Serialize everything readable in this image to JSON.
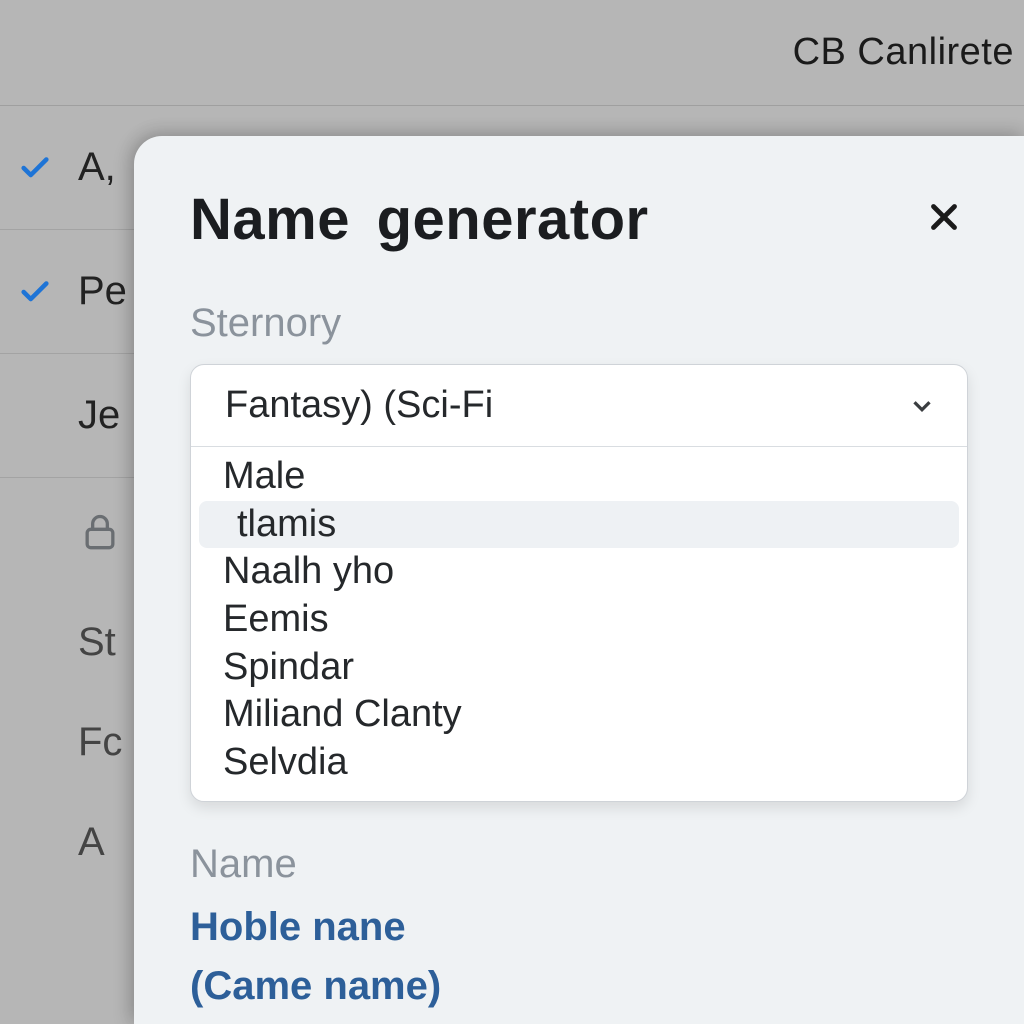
{
  "header": {
    "right": "CB Canlirete"
  },
  "bg": {
    "rows": [
      {
        "checked": true,
        "text": "A,"
      },
      {
        "checked": true,
        "text": "Pe"
      },
      {
        "checked": false,
        "text": "Je"
      }
    ],
    "lines": [
      "St",
      "Fc",
      "A"
    ]
  },
  "panel": {
    "title": "Name  generator",
    "sternory_label": "Sternory",
    "dropdown": {
      "selected": "Fantasy)  (Sci-Fi",
      "items": [
        "Male",
        "tlamis",
        "Naalh yho",
        "Eemis",
        "Spindar",
        "Miliand Clanty",
        "Selvdia"
      ],
      "highlight_index": 1
    },
    "name_label": "Name",
    "name_links": [
      "Hoble nane",
      "(Came name)"
    ]
  }
}
